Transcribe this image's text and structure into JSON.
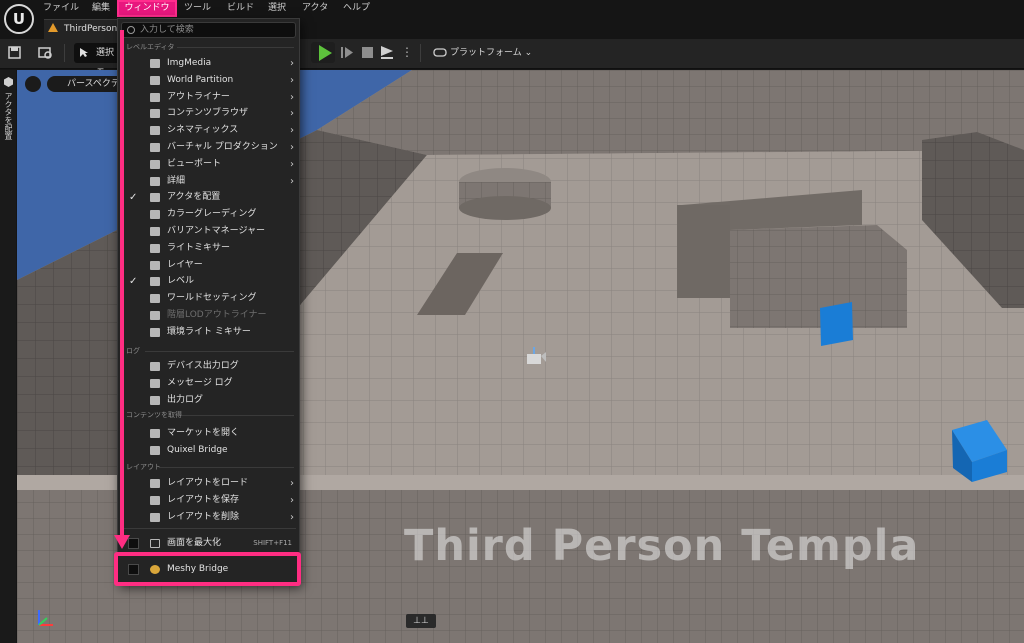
{
  "menubar": {
    "logo": "U",
    "items": [
      "ファイル",
      "編集",
      "ウィンドウ",
      "ツール",
      "ビルド",
      "選択",
      "アクタ",
      "ヘルプ"
    ]
  },
  "tab": {
    "title": "ThirdPersonM"
  },
  "toolbar": {
    "select_label": "選択モ",
    "platform_label": "プラットフォーム ⌄"
  },
  "sidepanel": {
    "label": "アクタを配置"
  },
  "viewport": {
    "perspective_label": "パースペクティ",
    "watermark": "Third Person Templa",
    "bottom_control": "⊥⊥"
  },
  "dropdown": {
    "search_placeholder": "入力して検索",
    "sections": {
      "level_editor": "レベルエディタ",
      "log": "ログ",
      "content": "コンテンツを取得",
      "layout": "レイアウト"
    },
    "level_items": [
      {
        "label": "ImgMedia",
        "arrow": "›",
        "check": ""
      },
      {
        "label": "World Partition",
        "arrow": "›",
        "check": ""
      },
      {
        "label": "アウトライナー",
        "arrow": "›",
        "check": ""
      },
      {
        "label": "コンテンツブラウザ",
        "arrow": "›",
        "check": ""
      },
      {
        "label": "シネマティックス",
        "arrow": "›",
        "check": ""
      },
      {
        "label": "バーチャル プロダクション",
        "arrow": "›",
        "check": ""
      },
      {
        "label": "ビューポート",
        "arrow": "›",
        "check": ""
      },
      {
        "label": "詳細",
        "arrow": "›",
        "check": ""
      },
      {
        "label": "アクタを配置",
        "arrow": "",
        "check": "✓"
      },
      {
        "label": "カラーグレーディング",
        "arrow": "",
        "check": ""
      },
      {
        "label": "バリアントマネージャー",
        "arrow": "",
        "check": ""
      },
      {
        "label": "ライトミキサー",
        "arrow": "",
        "check": ""
      },
      {
        "label": "レイヤー",
        "arrow": "",
        "check": ""
      },
      {
        "label": "レベル",
        "arrow": "",
        "check": "✓"
      },
      {
        "label": "ワールドセッティング",
        "arrow": "",
        "check": ""
      },
      {
        "label": "階層LODアウトライナー",
        "arrow": "",
        "check": ""
      },
      {
        "label": "環境ライト ミキサー",
        "arrow": "",
        "check": ""
      }
    ],
    "log_items": [
      {
        "label": "デバイス出力ログ"
      },
      {
        "label": "メッセージ ログ"
      },
      {
        "label": "出力ログ"
      }
    ],
    "content_items": [
      {
        "label": "マーケットを開く"
      },
      {
        "label": "Quixel Bridge"
      }
    ],
    "layout_items": [
      {
        "label": "レイアウトをロード",
        "arrow": "›"
      },
      {
        "label": "レイアウトを保存",
        "arrow": "›"
      },
      {
        "label": "レイアウトを削除",
        "arrow": "›"
      }
    ],
    "maximize": {
      "label": "画面を最大化",
      "shortcut": "SHIFT+F11"
    },
    "meshy": {
      "label": "Meshy Bridge"
    }
  },
  "colors": {
    "highlight": "#ff2d82",
    "play": "#5dc23c",
    "cube": "#1a7dd6"
  }
}
